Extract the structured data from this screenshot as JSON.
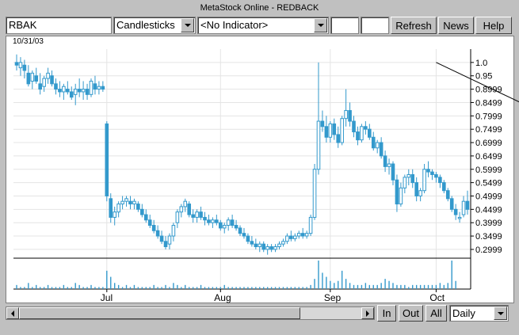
{
  "window": {
    "title": "MetaStock Online - REDBACK"
  },
  "toolbar": {
    "symbol_value": "RBAK",
    "chart_style": "Candlesticks",
    "indicator": "<No Indicator>",
    "field1_value": "",
    "field2_value": "",
    "refresh_label": "Refresh",
    "news_label": "News",
    "help_label": "Help"
  },
  "chart": {
    "date_label": "10/31/03"
  },
  "bottom": {
    "in_label": "In",
    "out_label": "Out",
    "all_label": "All",
    "period": "Daily"
  },
  "chart_data": {
    "type": "candlestick",
    "date_label": "10/31/03",
    "x_month_labels": [
      "Jul",
      "Aug",
      "Sep",
      "Oct"
    ],
    "y_tick_labels": [
      "1.0",
      "0.95",
      "0.8999",
      "0.8499",
      "0.7999",
      "0.7499",
      "0.6999",
      "0.6499",
      "0.5999",
      "0.5499",
      "0.4999",
      "0.4499",
      "0.3999",
      "0.3499",
      "0.2999"
    ],
    "ylim": [
      0.27,
      1.05
    ],
    "colors": {
      "candle": "#3399cc",
      "trend": "#000000",
      "grid": "#e4e4e4"
    },
    "trendline": [
      {
        "i": 107,
        "p": 1.0
      },
      {
        "i": 178,
        "p": 0.505
      }
    ],
    "candles": [
      {
        "o": 1.0,
        "h": 1.03,
        "l": 0.97,
        "c": 0.99
      },
      {
        "o": 0.98,
        "h": 1.02,
        "l": 0.95,
        "c": 1.0
      },
      {
        "o": 0.99,
        "h": 1.01,
        "l": 0.94,
        "c": 0.97
      },
      {
        "o": 0.96,
        "h": 0.99,
        "l": 0.91,
        "c": 0.92
      },
      {
        "o": 0.93,
        "h": 0.97,
        "l": 0.9,
        "c": 0.96
      },
      {
        "o": 0.95,
        "h": 0.98,
        "l": 0.92,
        "c": 0.93
      },
      {
        "o": 0.92,
        "h": 0.96,
        "l": 0.88,
        "c": 0.9
      },
      {
        "o": 0.91,
        "h": 0.95,
        "l": 0.89,
        "c": 0.94
      },
      {
        "o": 0.94,
        "h": 0.98,
        "l": 0.92,
        "c": 0.96
      },
      {
        "o": 0.95,
        "h": 0.97,
        "l": 0.91,
        "c": 0.92
      },
      {
        "o": 0.92,
        "h": 0.94,
        "l": 0.88,
        "c": 0.9
      },
      {
        "o": 0.9,
        "h": 0.93,
        "l": 0.87,
        "c": 0.89
      },
      {
        "o": 0.89,
        "h": 0.92,
        "l": 0.86,
        "c": 0.91
      },
      {
        "o": 0.9,
        "h": 0.93,
        "l": 0.88,
        "c": 0.89
      },
      {
        "o": 0.89,
        "h": 0.91,
        "l": 0.86,
        "c": 0.87
      },
      {
        "o": 0.88,
        "h": 0.92,
        "l": 0.84,
        "c": 0.9
      },
      {
        "o": 0.9,
        "h": 0.94,
        "l": 0.87,
        "c": 0.89
      },
      {
        "o": 0.89,
        "h": 0.93,
        "l": 0.86,
        "c": 0.9
      },
      {
        "o": 0.9,
        "h": 0.92,
        "l": 0.86,
        "c": 0.88
      },
      {
        "o": 0.88,
        "h": 0.94,
        "l": 0.87,
        "c": 0.93
      },
      {
        "o": 0.92,
        "h": 0.95,
        "l": 0.88,
        "c": 0.9
      },
      {
        "o": 0.9,
        "h": 0.93,
        "l": 0.88,
        "c": 0.91
      },
      {
        "o": 0.91,
        "h": 0.93,
        "l": 0.89,
        "c": 0.9
      },
      {
        "o": 0.77,
        "h": 0.78,
        "l": 0.48,
        "c": 0.5
      },
      {
        "o": 0.49,
        "h": 0.51,
        "l": 0.4,
        "c": 0.42
      },
      {
        "o": 0.42,
        "h": 0.46,
        "l": 0.39,
        "c": 0.44
      },
      {
        "o": 0.44,
        "h": 0.48,
        "l": 0.42,
        "c": 0.47
      },
      {
        "o": 0.47,
        "h": 0.5,
        "l": 0.45,
        "c": 0.48
      },
      {
        "o": 0.48,
        "h": 0.5,
        "l": 0.46,
        "c": 0.49
      },
      {
        "o": 0.48,
        "h": 0.5,
        "l": 0.45,
        "c": 0.47
      },
      {
        "o": 0.47,
        "h": 0.49,
        "l": 0.45,
        "c": 0.48
      },
      {
        "o": 0.47,
        "h": 0.48,
        "l": 0.44,
        "c": 0.45
      },
      {
        "o": 0.45,
        "h": 0.47,
        "l": 0.42,
        "c": 0.43
      },
      {
        "o": 0.43,
        "h": 0.45,
        "l": 0.4,
        "c": 0.41
      },
      {
        "o": 0.41,
        "h": 0.43,
        "l": 0.38,
        "c": 0.39
      },
      {
        "o": 0.39,
        "h": 0.41,
        "l": 0.36,
        "c": 0.37
      },
      {
        "o": 0.37,
        "h": 0.39,
        "l": 0.34,
        "c": 0.35
      },
      {
        "o": 0.35,
        "h": 0.37,
        "l": 0.32,
        "c": 0.33
      },
      {
        "o": 0.33,
        "h": 0.35,
        "l": 0.3,
        "c": 0.31
      },
      {
        "o": 0.32,
        "h": 0.36,
        "l": 0.3,
        "c": 0.35
      },
      {
        "o": 0.35,
        "h": 0.4,
        "l": 0.33,
        "c": 0.39
      },
      {
        "o": 0.4,
        "h": 0.45,
        "l": 0.38,
        "c": 0.44
      },
      {
        "o": 0.44,
        "h": 0.47,
        "l": 0.42,
        "c": 0.46
      },
      {
        "o": 0.46,
        "h": 0.49,
        "l": 0.44,
        "c": 0.48
      },
      {
        "o": 0.47,
        "h": 0.48,
        "l": 0.42,
        "c": 0.43
      },
      {
        "o": 0.43,
        "h": 0.45,
        "l": 0.4,
        "c": 0.42
      },
      {
        "o": 0.42,
        "h": 0.45,
        "l": 0.4,
        "c": 0.44
      },
      {
        "o": 0.44,
        "h": 0.46,
        "l": 0.41,
        "c": 0.42
      },
      {
        "o": 0.42,
        "h": 0.44,
        "l": 0.39,
        "c": 0.41
      },
      {
        "o": 0.41,
        "h": 0.43,
        "l": 0.39,
        "c": 0.4
      },
      {
        "o": 0.4,
        "h": 0.42,
        "l": 0.38,
        "c": 0.41
      },
      {
        "o": 0.41,
        "h": 0.43,
        "l": 0.39,
        "c": 0.4
      },
      {
        "o": 0.4,
        "h": 0.41,
        "l": 0.37,
        "c": 0.38
      },
      {
        "o": 0.38,
        "h": 0.4,
        "l": 0.36,
        "c": 0.39
      },
      {
        "o": 0.39,
        "h": 0.42,
        "l": 0.37,
        "c": 0.41
      },
      {
        "o": 0.41,
        "h": 0.43,
        "l": 0.38,
        "c": 0.39
      },
      {
        "o": 0.39,
        "h": 0.41,
        "l": 0.37,
        "c": 0.38
      },
      {
        "o": 0.38,
        "h": 0.39,
        "l": 0.35,
        "c": 0.36
      },
      {
        "o": 0.36,
        "h": 0.38,
        "l": 0.34,
        "c": 0.35
      },
      {
        "o": 0.35,
        "h": 0.36,
        "l": 0.32,
        "c": 0.33
      },
      {
        "o": 0.33,
        "h": 0.35,
        "l": 0.31,
        "c": 0.32
      },
      {
        "o": 0.32,
        "h": 0.34,
        "l": 0.3,
        "c": 0.31
      },
      {
        "o": 0.31,
        "h": 0.33,
        "l": 0.29,
        "c": 0.32
      },
      {
        "o": 0.32,
        "h": 0.33,
        "l": 0.29,
        "c": 0.3
      },
      {
        "o": 0.3,
        "h": 0.32,
        "l": 0.28,
        "c": 0.31
      },
      {
        "o": 0.31,
        "h": 0.32,
        "l": 0.29,
        "c": 0.3
      },
      {
        "o": 0.3,
        "h": 0.32,
        "l": 0.29,
        "c": 0.31
      },
      {
        "o": 0.31,
        "h": 0.33,
        "l": 0.3,
        "c": 0.32
      },
      {
        "o": 0.32,
        "h": 0.34,
        "l": 0.31,
        "c": 0.33
      },
      {
        "o": 0.33,
        "h": 0.36,
        "l": 0.32,
        "c": 0.35
      },
      {
        "o": 0.35,
        "h": 0.37,
        "l": 0.33,
        "c": 0.34
      },
      {
        "o": 0.34,
        "h": 0.36,
        "l": 0.33,
        "c": 0.35
      },
      {
        "o": 0.35,
        "h": 0.37,
        "l": 0.34,
        "c": 0.36
      },
      {
        "o": 0.36,
        "h": 0.38,
        "l": 0.34,
        "c": 0.35
      },
      {
        "o": 0.35,
        "h": 0.37,
        "l": 0.34,
        "c": 0.36
      },
      {
        "o": 0.36,
        "h": 0.43,
        "l": 0.35,
        "c": 0.42
      },
      {
        "o": 0.42,
        "h": 0.62,
        "l": 0.41,
        "c": 0.6
      },
      {
        "o": 0.6,
        "h": 1.0,
        "l": 0.58,
        "c": 0.78
      },
      {
        "o": 0.78,
        "h": 0.82,
        "l": 0.74,
        "c": 0.76
      },
      {
        "o": 0.76,
        "h": 0.8,
        "l": 0.7,
        "c": 0.72
      },
      {
        "o": 0.72,
        "h": 0.78,
        "l": 0.7,
        "c": 0.77
      },
      {
        "o": 0.77,
        "h": 0.79,
        "l": 0.71,
        "c": 0.73
      },
      {
        "o": 0.73,
        "h": 0.76,
        "l": 0.68,
        "c": 0.7
      },
      {
        "o": 0.7,
        "h": 0.8,
        "l": 0.69,
        "c": 0.79
      },
      {
        "o": 0.79,
        "h": 0.9,
        "l": 0.76,
        "c": 0.82
      },
      {
        "o": 0.82,
        "h": 0.85,
        "l": 0.76,
        "c": 0.78
      },
      {
        "o": 0.78,
        "h": 0.8,
        "l": 0.72,
        "c": 0.74
      },
      {
        "o": 0.74,
        "h": 0.76,
        "l": 0.69,
        "c": 0.71
      },
      {
        "o": 0.71,
        "h": 0.77,
        "l": 0.7,
        "c": 0.76
      },
      {
        "o": 0.76,
        "h": 0.78,
        "l": 0.73,
        "c": 0.75
      },
      {
        "o": 0.75,
        "h": 0.77,
        "l": 0.71,
        "c": 0.72
      },
      {
        "o": 0.72,
        "h": 0.74,
        "l": 0.67,
        "c": 0.68
      },
      {
        "o": 0.68,
        "h": 0.71,
        "l": 0.66,
        "c": 0.7
      },
      {
        "o": 0.7,
        "h": 0.72,
        "l": 0.64,
        "c": 0.65
      },
      {
        "o": 0.65,
        "h": 0.67,
        "l": 0.59,
        "c": 0.61
      },
      {
        "o": 0.61,
        "h": 0.64,
        "l": 0.58,
        "c": 0.62
      },
      {
        "o": 0.62,
        "h": 0.63,
        "l": 0.54,
        "c": 0.56
      },
      {
        "o": 0.56,
        "h": 0.58,
        "l": 0.44,
        "c": 0.47
      },
      {
        "o": 0.47,
        "h": 0.55,
        "l": 0.46,
        "c": 0.53
      },
      {
        "o": 0.53,
        "h": 0.58,
        "l": 0.51,
        "c": 0.57
      },
      {
        "o": 0.57,
        "h": 0.6,
        "l": 0.54,
        "c": 0.58
      },
      {
        "o": 0.58,
        "h": 0.6,
        "l": 0.53,
        "c": 0.55
      },
      {
        "o": 0.55,
        "h": 0.57,
        "l": 0.48,
        "c": 0.5
      },
      {
        "o": 0.5,
        "h": 0.53,
        "l": 0.48,
        "c": 0.52
      },
      {
        "o": 0.52,
        "h": 0.62,
        "l": 0.51,
        "c": 0.6
      },
      {
        "o": 0.6,
        "h": 0.63,
        "l": 0.57,
        "c": 0.59
      },
      {
        "o": 0.59,
        "h": 0.6,
        "l": 0.56,
        "c": 0.58
      },
      {
        "o": 0.58,
        "h": 0.59,
        "l": 0.55,
        "c": 0.57
      },
      {
        "o": 0.57,
        "h": 0.58,
        "l": 0.53,
        "c": 0.55
      },
      {
        "o": 0.55,
        "h": 0.56,
        "l": 0.51,
        "c": 0.52
      },
      {
        "o": 0.52,
        "h": 0.53,
        "l": 0.48,
        "c": 0.49
      },
      {
        "o": 0.49,
        "h": 0.5,
        "l": 0.44,
        "c": 0.45
      },
      {
        "o": 0.45,
        "h": 0.47,
        "l": 0.41,
        "c": 0.43
      },
      {
        "o": 0.42,
        "h": 0.44,
        "l": 0.4,
        "c": 0.42
      },
      {
        "o": 0.43,
        "h": 0.5,
        "l": 0.42,
        "c": 0.48
      },
      {
        "o": 0.48,
        "h": 0.52,
        "l": 0.43,
        "c": 0.45
      }
    ],
    "volume": [
      2,
      1,
      1,
      3,
      1,
      2,
      1,
      1,
      2,
      1,
      1,
      1,
      2,
      1,
      1,
      3,
      2,
      1,
      1,
      2,
      1,
      1,
      1,
      9,
      6,
      3,
      2,
      1,
      2,
      1,
      2,
      1,
      1,
      1,
      1,
      2,
      1,
      1,
      2,
      1,
      3,
      2,
      1,
      2,
      1,
      1,
      1,
      2,
      1,
      1,
      1,
      1,
      1,
      2,
      1,
      1,
      1,
      1,
      1,
      1,
      1,
      1,
      1,
      1,
      1,
      1,
      1,
      1,
      1,
      1,
      1,
      1,
      1,
      1,
      1,
      2,
      5,
      14,
      8,
      6,
      4,
      3,
      4,
      9,
      5,
      3,
      2,
      2,
      2,
      3,
      2,
      2,
      2,
      3,
      5,
      4,
      3,
      2,
      2,
      2,
      1,
      2,
      2,
      2,
      2,
      2,
      2,
      2,
      3,
      2,
      3,
      14,
      4
    ]
  }
}
